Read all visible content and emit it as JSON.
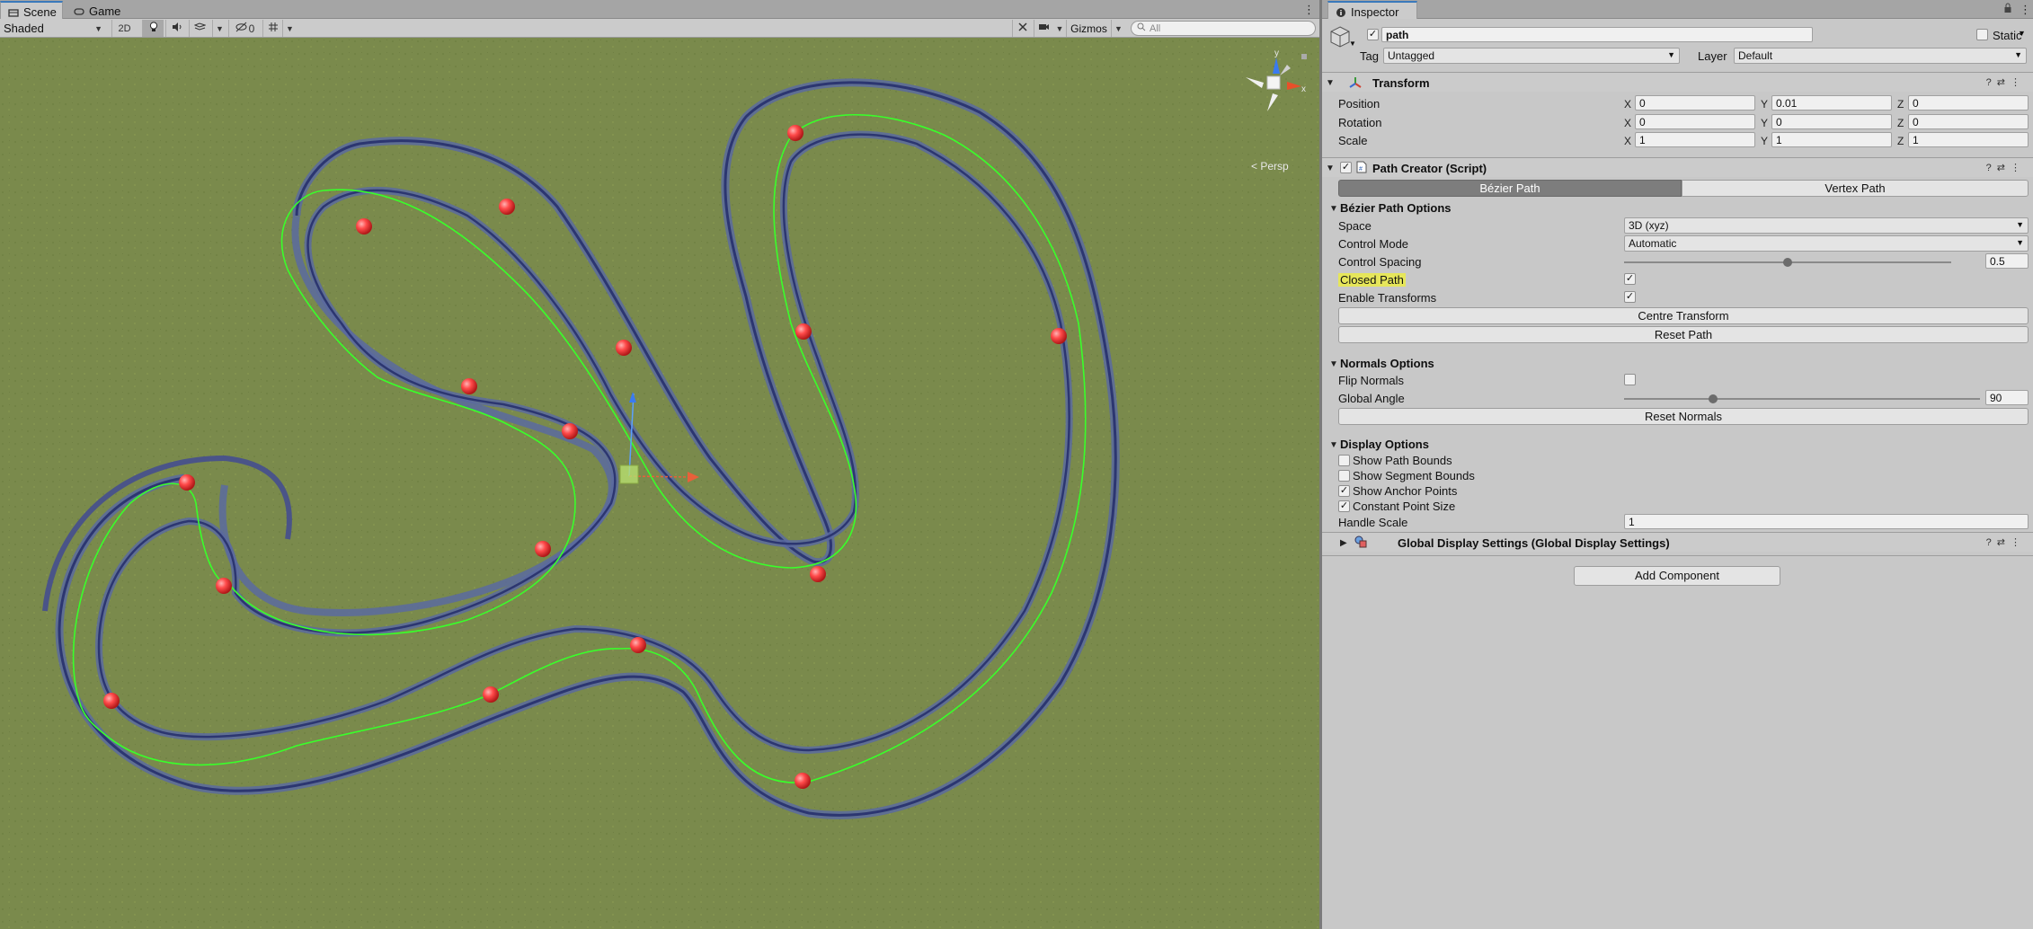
{
  "scene_panel": {
    "tabs": [
      {
        "label": "Scene",
        "active": true,
        "icon": "scene-icon"
      },
      {
        "label": "Game",
        "active": false,
        "icon": "game-controller-icon"
      }
    ],
    "toolbar": {
      "shading_mode": "Shaded",
      "mode_2d": "2D",
      "hidden_count": "0",
      "gizmos_label": "Gizmos",
      "search_placeholder": "All"
    },
    "gizmo": {
      "projection_label": "< Persp",
      "y_axis": "y",
      "x_axis": "x"
    },
    "colors": {
      "ground": "#7a8a4c",
      "wall": "#4a5488",
      "path_line": "#39ff2a",
      "anchor": "#ff4a4a"
    }
  },
  "inspector": {
    "tab_label": "Inspector",
    "object": {
      "active": true,
      "name": "path",
      "static_label": "Static",
      "static": false
    },
    "tag_label": "Tag",
    "tag_value": "Untagged",
    "layer_label": "Layer",
    "layer_value": "Default",
    "transform": {
      "title": "Transform",
      "position": {
        "label": "Position",
        "x": "0",
        "y": "0.01",
        "z": "0"
      },
      "rotation": {
        "label": "Rotation",
        "x": "0",
        "y": "0",
        "z": "0"
      },
      "scale": {
        "label": "Scale",
        "x": "1",
        "y": "1",
        "z": "1"
      },
      "axis_x": "X",
      "axis_y": "Y",
      "axis_z": "Z"
    },
    "path_creator": {
      "title": "Path Creator (Script)",
      "tab_bezier": "Bézier Path",
      "tab_vertex": "Vertex Path",
      "bezier_options_title": "Bézier Path Options",
      "space_label": "Space",
      "space_value": "3D (xyz)",
      "control_mode_label": "Control Mode",
      "control_mode_value": "Automatic",
      "control_spacing_label": "Control Spacing",
      "control_spacing_value": "0.5",
      "control_spacing_fraction": 0.5,
      "closed_path_label": "Closed Path",
      "closed_path": true,
      "enable_transforms_label": "Enable Transforms",
      "enable_transforms": true,
      "centre_transform_label": "Centre Transform",
      "reset_path_label": "Reset Path",
      "normals_title": "Normals Options",
      "flip_normals_label": "Flip Normals",
      "flip_normals": false,
      "global_angle_label": "Global Angle",
      "global_angle_value": "90",
      "global_angle_fraction": 0.25,
      "reset_normals_label": "Reset Normals",
      "display_title": "Display Options",
      "show_path_bounds_label": "Show Path Bounds",
      "show_path_bounds": false,
      "show_segment_bounds_label": "Show Segment Bounds",
      "show_segment_bounds": false,
      "show_anchor_points_label": "Show Anchor Points",
      "show_anchor_points": true,
      "constant_point_size_label": "Constant Point Size",
      "constant_point_size": true,
      "handle_scale_label": "Handle Scale",
      "handle_scale_value": "1",
      "global_display_label": "Global Display Settings (Global Display Settings)"
    },
    "add_component_label": "Add Component"
  }
}
